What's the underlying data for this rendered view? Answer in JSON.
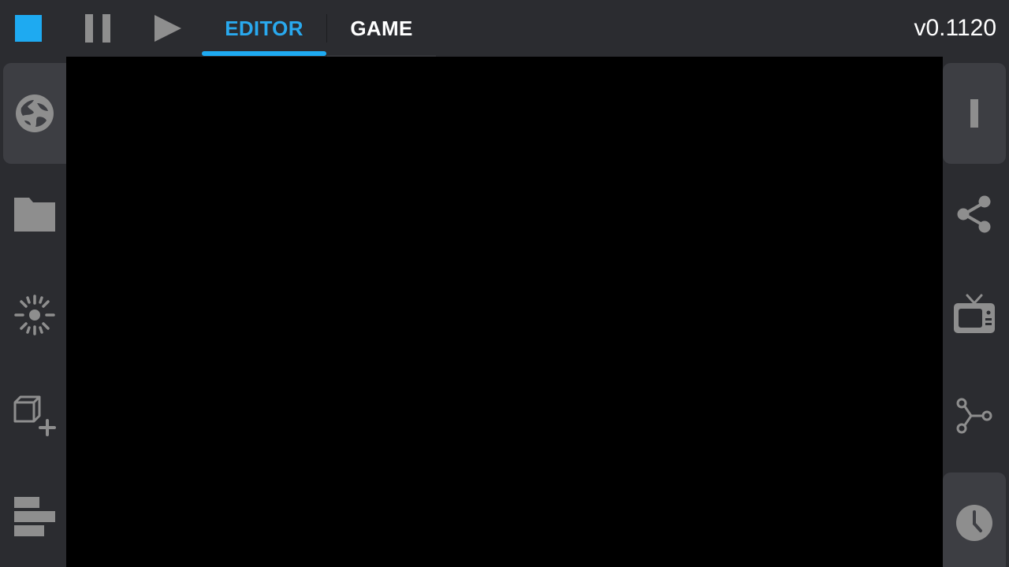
{
  "toolbar": {
    "stop_label": "",
    "tabs": [
      {
        "label": "EDITOR",
        "active": true
      },
      {
        "label": "GAME",
        "active": false
      }
    ],
    "version": "v0.1120"
  },
  "left_sidebar": {
    "items": [
      {
        "icon": "globe-icon",
        "active": true
      },
      {
        "icon": "folder-icon",
        "active": false
      },
      {
        "icon": "light-icon",
        "active": false
      },
      {
        "icon": "add-cube-icon",
        "active": false
      },
      {
        "icon": "align-bars-icon",
        "active": false
      }
    ]
  },
  "right_sidebar": {
    "items": [
      {
        "icon": "cursor-bar-icon",
        "active": true
      },
      {
        "icon": "share-icon",
        "active": false
      },
      {
        "icon": "tv-icon",
        "active": false
      },
      {
        "icon": "graph-nodes-icon",
        "active": false
      },
      {
        "icon": "clock-icon",
        "active": true
      }
    ]
  },
  "colors": {
    "accent": "#1eaaf1",
    "background": "#2b2c30",
    "active_button": "#3d3e43",
    "icon": "#8e8e8e",
    "viewport": "#000000"
  }
}
